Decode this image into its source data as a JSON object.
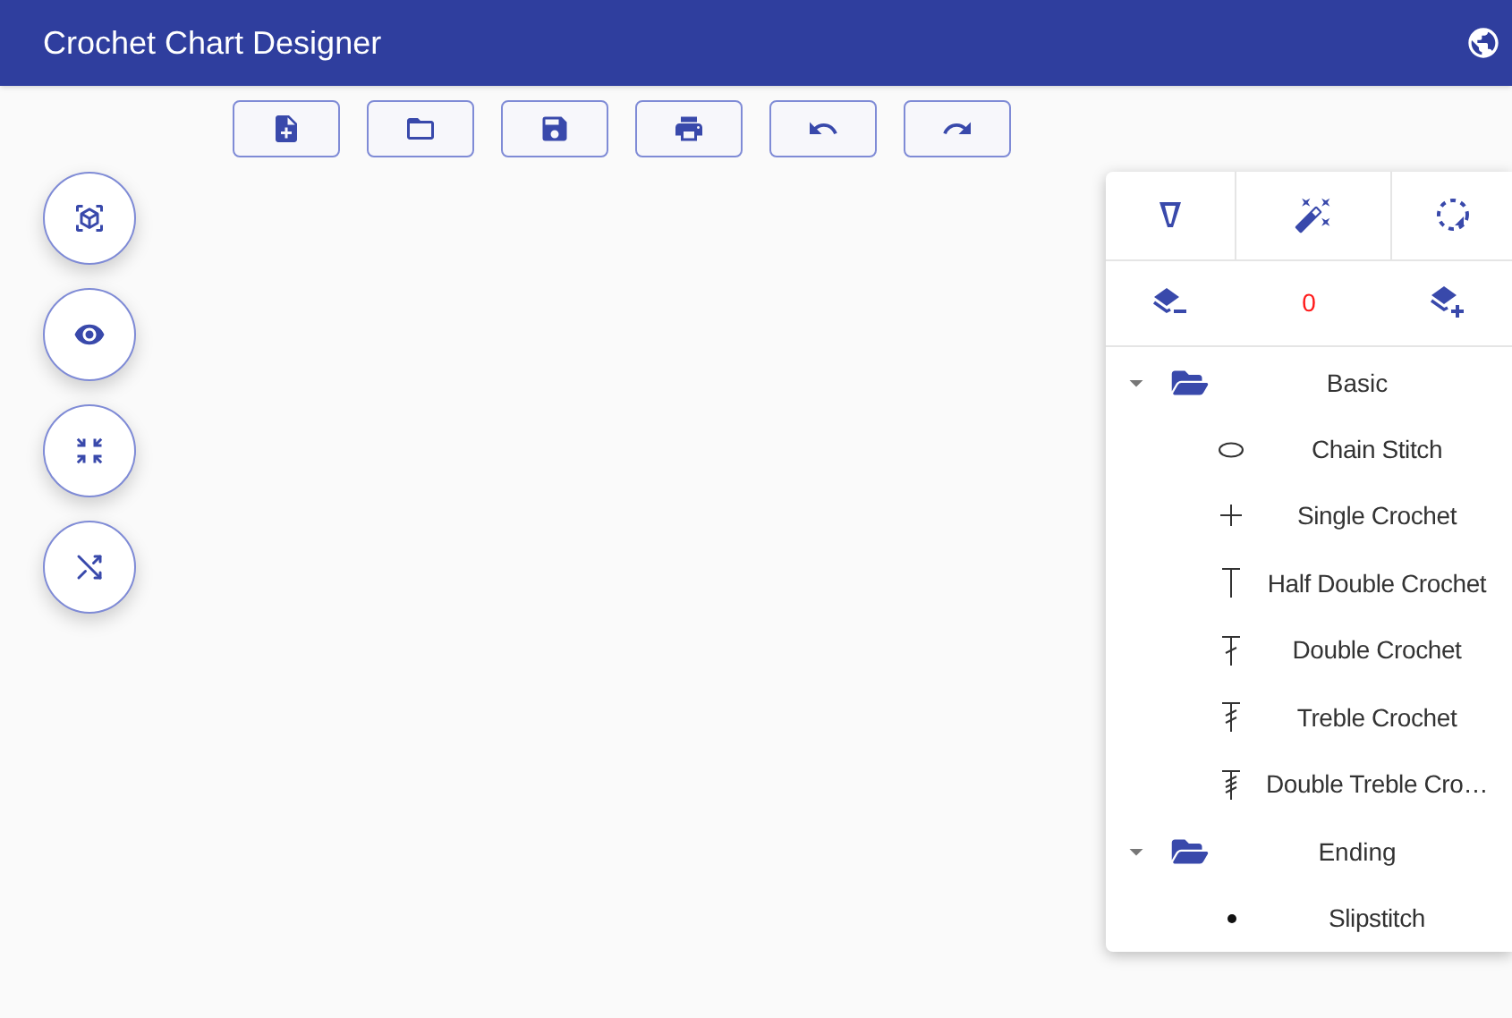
{
  "app_bar": {
    "title": "Crochet Chart Designer"
  },
  "layers": {
    "count": "0"
  },
  "stitch_tree": [
    {
      "label": "Basic",
      "expanded": true,
      "children": [
        {
          "label": "Chain Stitch",
          "kind": "chain"
        },
        {
          "label": "Single Crochet",
          "kind": "single"
        },
        {
          "label": "Half Double Crochet",
          "kind": "half-double"
        },
        {
          "label": "Double Crochet",
          "kind": "double"
        },
        {
          "label": "Treble Crochet",
          "kind": "treble"
        },
        {
          "label": "Double Treble Cro…",
          "kind": "double-treble"
        }
      ]
    },
    {
      "label": "Ending",
      "expanded": true,
      "children": [
        {
          "label": "Slipstitch",
          "kind": "slip"
        }
      ]
    }
  ]
}
